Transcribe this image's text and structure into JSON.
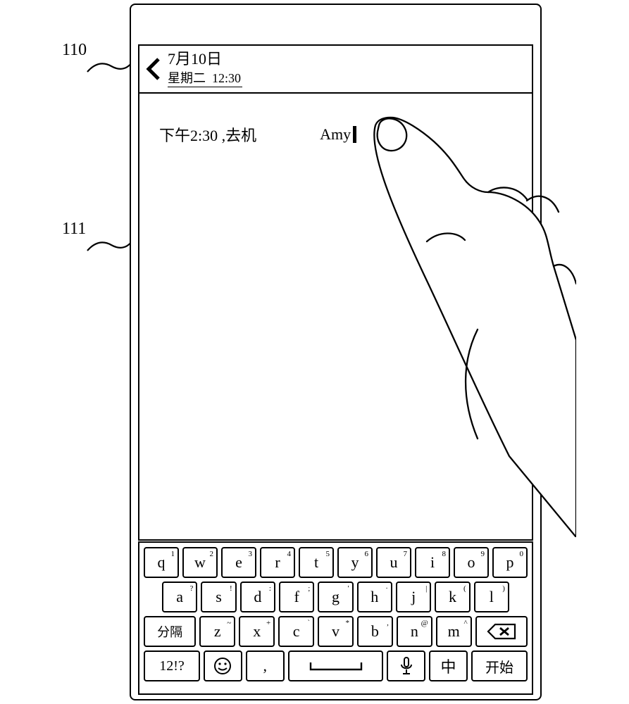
{
  "callouts": {
    "header": "110",
    "content": "111"
  },
  "header": {
    "date": "7月10日",
    "day": "星期二",
    "time": "12:30"
  },
  "content": {
    "text_before": "下午2:30 ,去机",
    "text_after": "Amy"
  },
  "keyboard": {
    "row1": [
      {
        "main": "q",
        "sup": "1"
      },
      {
        "main": "w",
        "sup": "2"
      },
      {
        "main": "e",
        "sup": "3"
      },
      {
        "main": "r",
        "sup": "4"
      },
      {
        "main": "t",
        "sup": "5"
      },
      {
        "main": "y",
        "sup": "6"
      },
      {
        "main": "u",
        "sup": "7"
      },
      {
        "main": "i",
        "sup": "8"
      },
      {
        "main": "o",
        "sup": "9"
      },
      {
        "main": "p",
        "sup": "0"
      }
    ],
    "row2": [
      {
        "main": "a",
        "sup": "?"
      },
      {
        "main": "s",
        "sup": "!"
      },
      {
        "main": "d",
        "sup": ":"
      },
      {
        "main": "f",
        "sup": ";"
      },
      {
        "main": "g",
        "sup": "'"
      },
      {
        "main": "h",
        "sup": "·"
      },
      {
        "main": "j",
        "sup": "|"
      },
      {
        "main": "k",
        "sup": "("
      },
      {
        "main": "l",
        "sup": ")"
      }
    ],
    "row3_sep": "分隔",
    "row3": [
      {
        "main": "z",
        "sup": "~"
      },
      {
        "main": "x",
        "sup": "+"
      },
      {
        "main": "c",
        "sup": "`"
      },
      {
        "main": "v",
        "sup": "*"
      },
      {
        "main": "b",
        "sup": ","
      },
      {
        "main": "n",
        "sup": "@"
      },
      {
        "main": "m",
        "sup": "^"
      }
    ],
    "row4": {
      "sym": "12!?",
      "comma": ",",
      "lang": "中",
      "start": "开始"
    }
  }
}
